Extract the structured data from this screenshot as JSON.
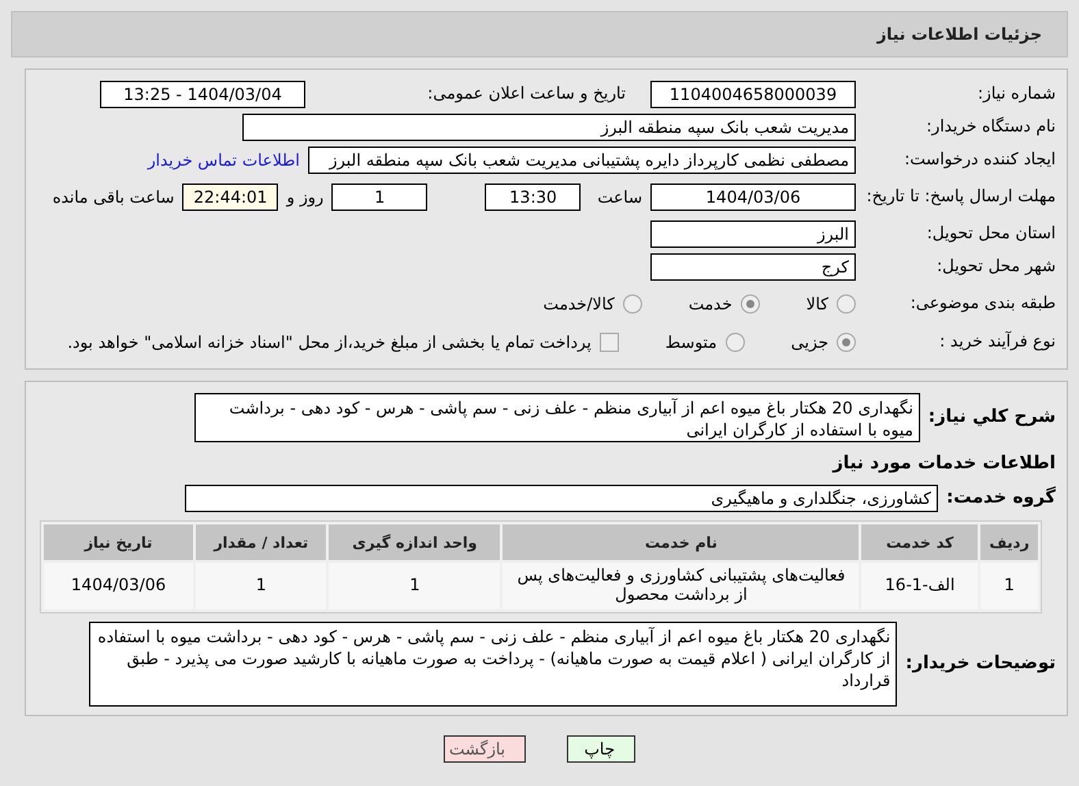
{
  "header": {
    "title": "جزئیات اطلاعات نیاز"
  },
  "need_number": {
    "label": "شماره نیاز:",
    "value": "1104004658000039"
  },
  "announce": {
    "label": "تاریخ و ساعت اعلان عمومی:",
    "value": "1404/03/04 - 13:25"
  },
  "buyer_org": {
    "label": "نام دستگاه خریدار:",
    "value": "مدیریت شعب بانک سپه منطقه البرز"
  },
  "requester": {
    "label": "ایجاد کننده درخواست:",
    "value": "مصطفی نظمی کارپرداز دایره پشتیبانی مدیریت شعب بانک سپه منطقه البرز",
    "link": "اطلاعات تماس خریدار"
  },
  "deadline": {
    "label": "مهلت ارسال پاسخ: تا تاریخ:",
    "date": "1404/03/06",
    "time_label": "ساعت",
    "time": "13:30",
    "days": "1",
    "days_label": "روز و",
    "remaining": "22:44:01",
    "remaining_label": "ساعت باقی مانده"
  },
  "province": {
    "label": "استان محل تحویل:",
    "value": "البرز"
  },
  "city": {
    "label": "شهر محل تحویل:",
    "value": "کرج"
  },
  "category": {
    "label": "طبقه بندی موضوعی:",
    "options": [
      {
        "label": "کالا",
        "selected": false
      },
      {
        "label": "خدمت",
        "selected": true
      },
      {
        "label": "کالا/خدمت",
        "selected": false
      }
    ]
  },
  "purchase_type": {
    "label": "نوع فرآیند خرید :",
    "options": [
      {
        "label": "جزیی",
        "selected": true
      },
      {
        "label": "متوسط",
        "selected": false
      }
    ],
    "treasury": {
      "checked": false,
      "label": "پرداخت تمام یا بخشی از مبلغ خرید،از محل \"اسناد خزانه اسلامی\" خواهد بود."
    }
  },
  "description": {
    "label": "شرح کلي نياز:",
    "value": "نگهداری 20 هکتار باغ میوه اعم از آبیاری منظم  - علف زنی - سم پاشی - هرس - کود دهی - برداشت میوه با استفاده از کارگران ایرانی"
  },
  "services_title": "اطلاعات خدمات مورد نياز",
  "service_group": {
    "label": "گروه خدمت:",
    "value": "کشاورزی، جنگلداری و ماهیگیری"
  },
  "table": {
    "columns": [
      "ردیف",
      "کد خدمت",
      "نام خدمت",
      "واحد اندازه گیری",
      "تعداد / مقدار",
      "تاریخ نیاز"
    ],
    "rows": [
      [
        "1",
        "الف-1-16",
        "فعالیت‌های پشتیبانی کشاورزی و فعالیت‌های پس از برداشت محصول",
        "1",
        "1",
        "1404/03/06"
      ]
    ]
  },
  "buyer_notes": {
    "label": "توضیحات خریدار:",
    "value": "نگهداری 20 هکتار باغ میوه اعم از آبیاری منظم  - علف زنی - سم پاشی - هرس - کود دهی - برداشت میوه با استفاده از کارگران ایرانی ( اعلام قیمت به صورت ماهیانه) - پرداخت به صورت ماهیانه با کارشید صورت می پذیرد - طبق قرارداد"
  },
  "buttons": [
    {
      "kind": "print",
      "label": "چاپ"
    },
    {
      "kind": "back",
      "label": "بازگشت"
    }
  ]
}
